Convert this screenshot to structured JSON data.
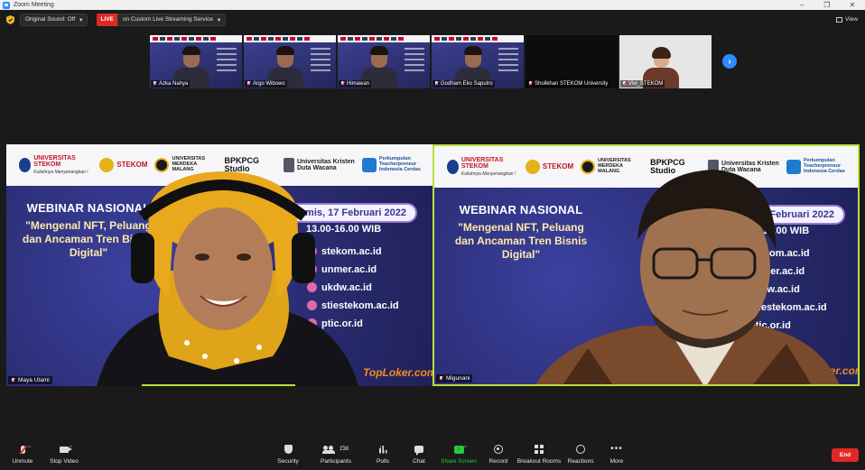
{
  "window": {
    "title": "Zoom Meeting"
  },
  "topbar": {
    "sound_label": "Original Sound: Off",
    "live_label": "LIVE",
    "stream_label": "on Custom Live Streaming Service",
    "view_label": "View"
  },
  "thumbnails": [
    {
      "name": "Azka Nahya",
      "kind": "presenter"
    },
    {
      "name": "Argo Wibowo",
      "kind": "presenter"
    },
    {
      "name": "Himawan",
      "kind": "presenter"
    },
    {
      "name": "Godham Eko Saputro",
      "kind": "presenter"
    },
    {
      "name": "Sholikhan STEKOM University",
      "kind": "black"
    },
    {
      "name": "Vivi_STEKOM",
      "kind": "light"
    }
  ],
  "slide": {
    "logos": [
      "UNIVERSITAS STEKOM",
      "STEKOM",
      "UNIVERSITAS MERDEKA MALANG",
      "BPKPCG Studio",
      "Universitas Kristen Duta Wacana",
      "Perkumpulan Teacherpreneur Indonesia Cerdas"
    ],
    "logo_tagline": "Kuliahnya Menyenangkan !",
    "heading": "WEBINAR NASIONAL",
    "topic": "\"Mengenal NFT, Peluang dan Ancaman Tren Bisnis Digital\"",
    "date": "Kamis, 17 Februari 2022",
    "time": "13.00-16.00 WIB",
    "sites": [
      "stekom.ac.id",
      "unmer.ac.id",
      "ukdw.ac.id",
      "stiestekom.ac.id",
      "ptic.or.id"
    ],
    "sponsor": "TopLoker.com"
  },
  "speakers": [
    {
      "name": "Maya Utami"
    },
    {
      "name": "Migunani"
    }
  ],
  "toolbar": {
    "unmute": "Unmute",
    "stop_video": "Stop Video",
    "security": "Security",
    "participants": "Participants",
    "participants_count": "138",
    "polls": "Polls",
    "chat": "Chat",
    "share_screen": "Share Screen",
    "record": "Record",
    "breakout": "Breakout Rooms",
    "reactions": "Reactions",
    "more": "More",
    "end": "End"
  },
  "colors": {
    "accent": "#2d8cff",
    "live": "#e02828",
    "active_speaker": "#b6e23a",
    "share_green": "#28c840",
    "slide_bg": "#2c2e73"
  }
}
